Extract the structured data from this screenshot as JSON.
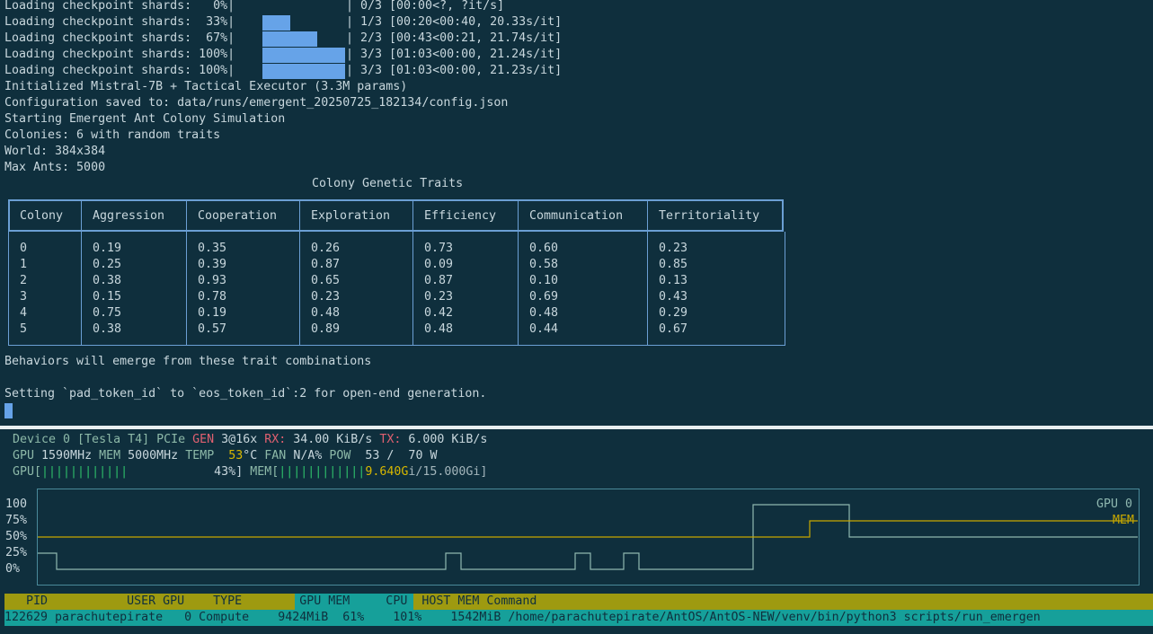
{
  "terminal": {
    "progress": [
      {
        "label": "Loading checkpoint shards:   0%|",
        "fraction": 0.0,
        "tail": "| 0/3 [00:00<?, ?it/s]"
      },
      {
        "label": "Loading checkpoint shards:  33%|",
        "fraction": 0.333,
        "tail": "| 1/3 [00:20<00:40, 20.33s/it]"
      },
      {
        "label": "Loading checkpoint shards:  67%|",
        "fraction": 0.667,
        "tail": "| 2/3 [00:43<00:21, 21.74s/it]"
      },
      {
        "label": "Loading checkpoint shards: 100%|",
        "fraction": 1.0,
        "tail": "| 3/3 [01:03<00:00, 21.24s/it]"
      },
      {
        "label": "Loading checkpoint shards: 100%|",
        "fraction": 1.0,
        "tail": "| 3/3 [01:03<00:00, 21.23s/it]"
      }
    ],
    "lines": [
      "Initialized Mistral-7B + Tactical Executor (3.3M params)",
      "Configuration saved to: data/runs/emergent_20250725_182134/config.json",
      "Starting Emergent Ant Colony Simulation",
      "Colonies: 6 with random traits",
      "World: 384x384",
      "Max Ants: 5000"
    ],
    "table": {
      "title": "Colony Genetic Traits",
      "headers": [
        "Colony",
        "Aggression",
        "Cooperation",
        "Exploration",
        "Efficiency",
        "Communication",
        "Territoriality"
      ],
      "rows": [
        [
          "0",
          "0.19",
          "0.35",
          "0.26",
          "0.73",
          "0.60",
          "0.23"
        ],
        [
          "1",
          "0.25",
          "0.39",
          "0.87",
          "0.09",
          "0.58",
          "0.85"
        ],
        [
          "2",
          "0.38",
          "0.93",
          "0.65",
          "0.87",
          "0.10",
          "0.13"
        ],
        [
          "3",
          "0.15",
          "0.78",
          "0.23",
          "0.23",
          "0.69",
          "0.43"
        ],
        [
          "4",
          "0.75",
          "0.19",
          "0.48",
          "0.42",
          "0.48",
          "0.29"
        ],
        [
          "5",
          "0.38",
          "0.57",
          "0.89",
          "0.48",
          "0.44",
          "0.67"
        ]
      ]
    },
    "after_table": "Behaviors will emerge from these trait combinations",
    "pad_msg": "Setting `pad_token_id` to `eos_token_id`:2 for open-end generation."
  },
  "nvtop": {
    "device_line": {
      "device": "Device 0 [Tesla T4] PCIe ",
      "gen_label": "GEN",
      "gen_val": " 3@16x ",
      "rx_label": "RX:",
      "rx_val": " 34.00 KiB/s ",
      "tx_label": "TX:",
      "tx_val": " 6.000 KiB/s"
    },
    "clock_line": {
      "gpu_label": "GPU",
      "gpu_val": " 1590MHz ",
      "mem_label": "MEM",
      "mem_val": " 5000MHz ",
      "temp_label": "TEMP",
      "temp_val": "  53",
      "temp_unit": "°C ",
      "fan_label": "FAN",
      "fan_val": " N/A% ",
      "pow_label": "POW",
      "pow_val": "  53 /  70 W"
    },
    "usage_line": {
      "gpu_prefix": "GPU[",
      "gpu_bars": "||||||||||||",
      "gpu_pct": "            43%]",
      "mem_prefix": " MEM[",
      "mem_bars": "||||||||||||",
      "mem_used": "9.640G",
      "mem_rest": "i/15.000Gi]"
    },
    "graph": {
      "y_ticks": [
        "100",
        "75%",
        "50%",
        "25%",
        "0%"
      ],
      "legend_gpu": "GPU 0",
      "legend_mem": "MEM",
      "colors": {
        "gpu": "#8fb8b0",
        "mem": "#c8a800"
      }
    },
    "processes": {
      "header": "   PID           USER GPU    TYPE",
      "header_hl": "        GPU MEM",
      "header_rest": "     CPU  HOST MEM Command",
      "row": "122629 parachutepirate   0 Compute    9424MiB  61%    101%    1542MiB /home/parachutepirate/AntOS/AntOS-NEW/venv/bin/python3 scripts/run_emergen"
    }
  }
}
